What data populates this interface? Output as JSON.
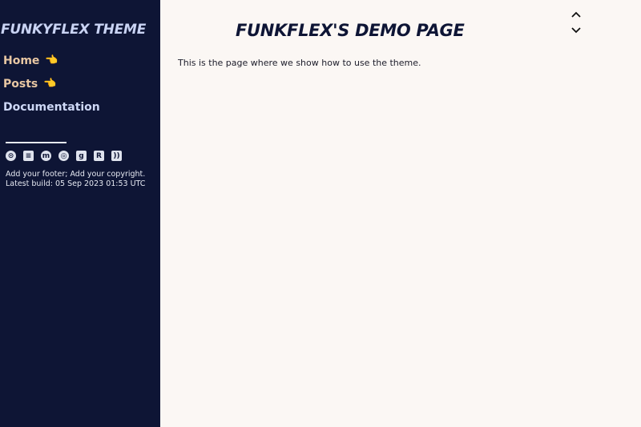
{
  "sidebar": {
    "site_title": "FUNKYFLEX THEME",
    "nav": [
      {
        "label": "Home",
        "icon": "pointing-hand-icon",
        "hand": "👈"
      },
      {
        "label": "Posts",
        "icon": "pointing-hand-icon",
        "hand": "👈"
      },
      {
        "label": "Documentation"
      }
    ],
    "social_icons": [
      "github-icon",
      "stackoverflow-icon",
      "mastodon-icon",
      "orcid-icon",
      "google-scholar-icon",
      "researchgate-icon",
      "rss-icon"
    ],
    "social_glyphs": [
      "⊙",
      "≡",
      "m",
      "◎",
      "g",
      "R",
      "))"
    ],
    "footer": {
      "line1": "Add your footer; Add your copyright.",
      "line2": "Latest build: 05 Sep 2023 01:53 UTC"
    }
  },
  "main": {
    "title": "FUNKFLEX'S DEMO PAGE",
    "intro": "This is the page where we show how to use the theme."
  },
  "colors": {
    "sidebar_bg": "#0e1535",
    "page_bg": "#fbf7f4",
    "nav_accent": "#e8c7a3",
    "title_blue": "#c9d3f3"
  }
}
